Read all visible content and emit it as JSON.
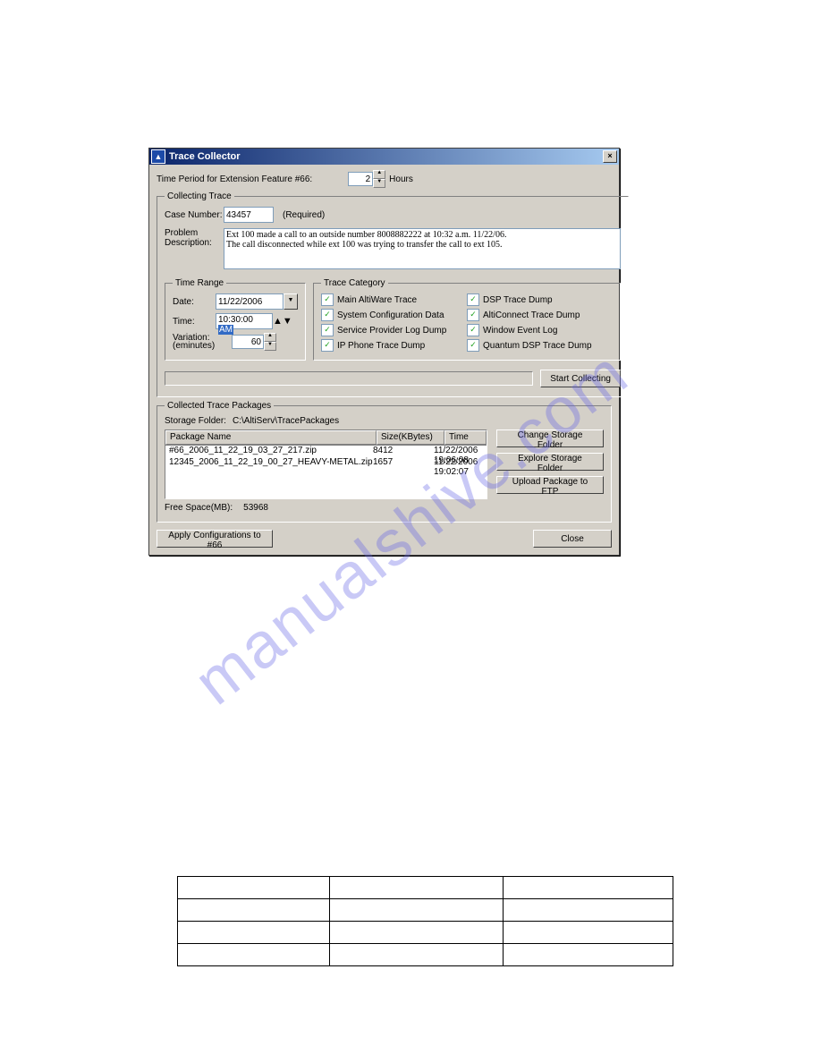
{
  "dialog": {
    "title": "Trace Collector",
    "time_period_label": "Time Period for Extension Feature #66:",
    "time_period_value": "2",
    "time_period_unit": "Hours"
  },
  "collecting": {
    "legend": "Collecting Trace",
    "case_label": "Case Number:",
    "case_value": "43457",
    "case_req": "(Required)",
    "desc_label": "Problem\nDescription:",
    "desc_value": "Ext 100 made a call to an outside number 8008882222 at 10:32 a.m. 11/22/06.\nThe call disconnected while ext 100 was trying to transfer the call to ext 105."
  },
  "timerange": {
    "legend": "Time Range",
    "date_label": "Date:",
    "date_value": "11/22/2006",
    "time_label": "Time:",
    "time_value_a": "10:30:00 ",
    "time_value_b": "AM",
    "var_label": "Variation:\n(eminutes)",
    "var_value": "60"
  },
  "tracecat": {
    "legend": "Trace Category",
    "left": [
      "Main AltiWare Trace",
      "System Configuration Data",
      "Service Provider Log Dump",
      "IP Phone Trace Dump"
    ],
    "right": [
      "DSP Trace Dump",
      "AltiConnect Trace Dump",
      "Window Event Log",
      "Quantum DSP Trace Dump"
    ]
  },
  "start_btn": "Start Collecting",
  "packages": {
    "legend": "Collected Trace Packages",
    "storage_label": "Storage Folder:",
    "storage_value": "C:\\AltiServ\\TracePackages",
    "headers": [
      "Package Name",
      "Size(KBytes)",
      "Time"
    ],
    "rows": [
      {
        "name": "#66_2006_11_22_19_03_27_217.zip",
        "size": "8412",
        "time": "11/22/2006 19:06:08"
      },
      {
        "name": "12345_2006_11_22_19_00_27_HEAVY-METAL.zip",
        "size": "1657",
        "time": "11/22/2006 19:02:07"
      }
    ],
    "free_label": "Free Space(MB):",
    "free_value": "53968",
    "btn_change": "Change Storage Folder",
    "btn_explore": "Explore Storage Folder",
    "btn_upload": "Upload Package to FTP"
  },
  "bottom": {
    "apply": "Apply Configurations to #66",
    "close": "Close"
  },
  "watermark": "manualshive.com"
}
